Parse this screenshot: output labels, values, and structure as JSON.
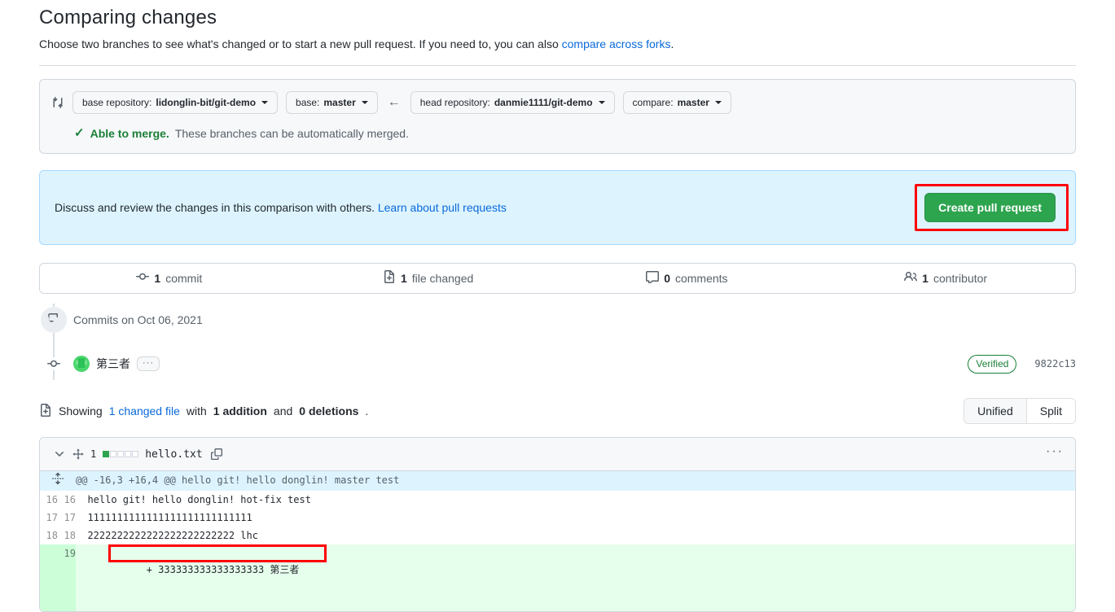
{
  "header": {
    "title": "Comparing changes",
    "subtitle_before": "Choose two branches to see what's changed or to start a new pull request. If you need to, you can also ",
    "subtitle_link": "compare across forks",
    "subtitle_after": "."
  },
  "branch_bar": {
    "compare_icon": "git-compare-icon",
    "base_repository_label": "base repository:",
    "base_repository_value": "lidonglin-bit/git-demo",
    "base_label": "base:",
    "base_value": "master",
    "arrow": "←",
    "head_repository_label": "head repository:",
    "head_repository_value": "danmie1111/git-demo",
    "compare_label": "compare:",
    "compare_value": "master",
    "merge_check": "✓",
    "merge_status_bold": "Able to merge.",
    "merge_status_rest": "These branches can be automatically merged."
  },
  "discuss": {
    "text": "Discuss and review the changes in this comparison with others.",
    "link": "Learn about pull requests",
    "button_label": "Create pull request",
    "button_color": "#2da44e",
    "banner_color": "#ddf4ff",
    "annotation_color": "#fe0000"
  },
  "stats": [
    {
      "icon": "commit-icon",
      "count": "1",
      "label": "commit"
    },
    {
      "icon": "file-diff-icon",
      "count": "1",
      "label": "file changed"
    },
    {
      "icon": "comment-icon",
      "count": "0",
      "label": "comments"
    },
    {
      "icon": "people-icon",
      "count": "1",
      "label": "contributor"
    }
  ],
  "timeline": {
    "date_header": "Commits on Oct 06, 2021",
    "commit": {
      "author_avatar": "avatar",
      "message": "第三者",
      "expand_label": "···",
      "verified_label": "Verified",
      "sha": "9822c13"
    }
  },
  "diff_summary": {
    "showing": "Showing",
    "changed_file": "1 changed file",
    "with": "with",
    "additions": "1 addition",
    "and": "and",
    "deletions": "0 deletions",
    "period": ".",
    "view_unified": "Unified",
    "view_split": "Split"
  },
  "file": {
    "change_count": "1",
    "name": "hello.txt",
    "diffstat_added": 1,
    "diffstat_total": 5,
    "menu": "···",
    "hunk_header": "@@ -16,3 +16,4 @@ hello git! hello donglin! master test",
    "rows": [
      {
        "type": "ctx",
        "old": "16",
        "new": "16",
        "code": "  hello git! hello donglin! hot-fix test"
      },
      {
        "type": "ctx",
        "old": "17",
        "new": "17",
        "code": "  1111111111111111111111111111"
      },
      {
        "type": "ctx",
        "old": "18",
        "new": "18",
        "code": "  2222222222222222222222222 lhc"
      },
      {
        "type": "add",
        "old": "",
        "new": "19",
        "code": "+ 333333333333333333 第三者"
      }
    ]
  }
}
